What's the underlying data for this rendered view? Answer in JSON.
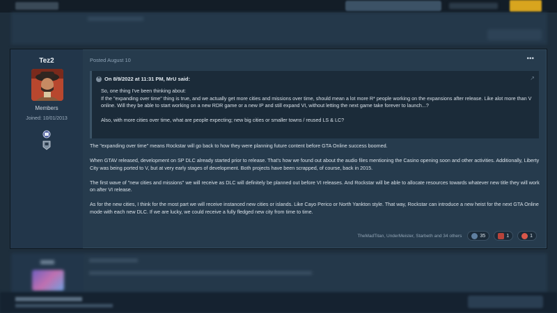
{
  "post": {
    "author": "Tez2",
    "group": "Members",
    "joined": "Joined: 10/01/2013",
    "posted": "Posted August 10",
    "more_icon": "more-horizontal-icon",
    "quote": {
      "header": "On 8/9/2022 at 11:31 PM, MrU said:",
      "paragraphs": [
        "So, one thing I've been thinking about:",
        "If the \"expanding over time\" thing is true, and we actually get more cities and missions over time, should mean a lot more R* people working on the expansions after release. Like alot more than V online. Will they be able to start working on a new RDR game or a new IP and still expand VI, without letting the next game take forever to launch...?",
        "Also, with more cities over time, what are people expecting; new big cities or smaller towns / reused LS & LC?"
      ]
    },
    "body": [
      "The \"expanding over time\" means Rockstar will go back to how they were planning future content before GTA Online success boomed.",
      "When GTAV released, development on SP DLC already started prior to release. That's how we found out about the audio files mentioning the Casino opening soon and other activities. Additionally, Liberty City was being ported to V, but at very early stages of development. Both projects have been scrapped, of course, back in 2015.",
      "The first wave of \"new cities and missions\" we will receive as DLC will definitely be planned out before VI releases. And Rockstar will be able to allocate resources towards whatever new title they will work on after VI release.",
      "As for the new cities, I think for the most part we will receive instanced new cities or islands. Like Cayo Perico or North Yankton style. That way, Rockstar can introduce a new heist for the next GTA Online mode with each new DLC. If we are lucky, we could receive a fully fledged new city from time to time."
    ],
    "reacted_by": "TheMadTitan, UnderMeister, Starbeth and 34 others",
    "reactions": [
      {
        "icon": "like-icon",
        "count": "35",
        "color": "#5f7fa0"
      },
      {
        "icon": "tea-icon",
        "count": "1",
        "color": "#b7433a"
      },
      {
        "icon": "heart-icon",
        "count": "1",
        "color": "#d9574a"
      }
    ]
  },
  "colors": {
    "background": "#1e2e3c",
    "post_bg": "#263b4d",
    "quote_bg": "#1b2b39",
    "accent_button": "#d8a51e"
  }
}
